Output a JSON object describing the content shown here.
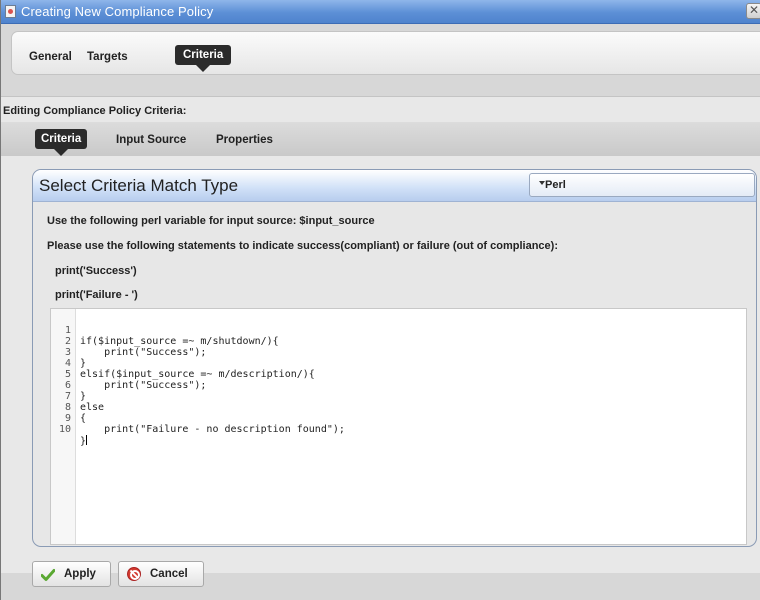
{
  "window": {
    "title": "Creating New Compliance Policy",
    "close_glyph": "✕"
  },
  "top_tabs": [
    {
      "label": "General",
      "active": false
    },
    {
      "label": "Targets",
      "active": false
    },
    {
      "label": "Criteria",
      "active": true
    }
  ],
  "editing_heading": "Editing Compliance Policy Criteria:",
  "sub_tabs": [
    {
      "label": "Criteria",
      "active": true
    },
    {
      "label": "Input Source",
      "active": false
    },
    {
      "label": "Properties",
      "active": false
    }
  ],
  "match": {
    "title": "Select Criteria Match Type",
    "language": "Perl"
  },
  "info": {
    "line1": "Use the following perl variable for input source: $input_source",
    "line2": "Please use the following statements to indicate success(compliant) or failure (out of compliance):",
    "line3": "print('Success')",
    "line4": "print('Failure - ')"
  },
  "code": {
    "lines": [
      {
        "n": "1",
        "text": "if($input_source =~ m/shutdown/){"
      },
      {
        "n": "2",
        "text": "    print(\"Success\");"
      },
      {
        "n": "3",
        "text": "}"
      },
      {
        "n": "4",
        "text": "elsif($input_source =~ m/description/){"
      },
      {
        "n": "5",
        "text": "    print(\"Success\");"
      },
      {
        "n": "6",
        "text": "}"
      },
      {
        "n": "7",
        "text": "else"
      },
      {
        "n": "8",
        "text": "{"
      },
      {
        "n": "9",
        "text": "    print(\"Failure - no description found\");"
      },
      {
        "n": "10",
        "text": "}"
      }
    ]
  },
  "buttons": {
    "apply": "Apply",
    "cancel": "Cancel"
  },
  "colors": {
    "title_bar": "#5c8fd6",
    "active_tab": "#2b2b2b",
    "apply_icon": "#5aa832",
    "cancel_icon": "#d33a2f"
  }
}
